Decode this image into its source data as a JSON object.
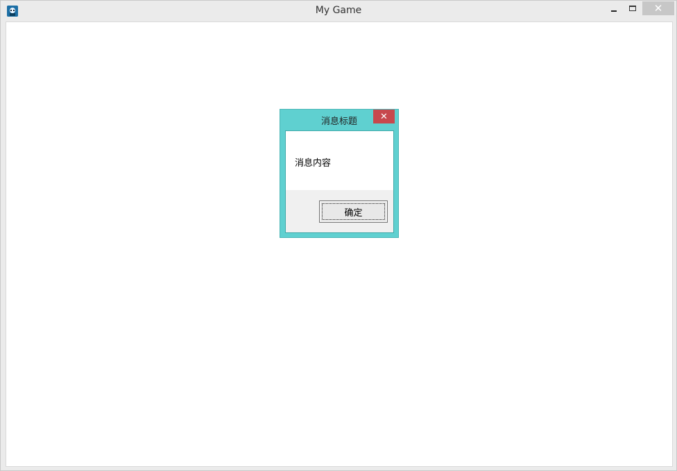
{
  "window": {
    "title": "My Game",
    "app_icon": "game-app-icon",
    "controls": {
      "minimize": "minimize-icon",
      "maximize": "maximize-icon",
      "close": "✕"
    }
  },
  "dialog": {
    "title": "消息标题",
    "close_label": "✕",
    "message": "消息内容",
    "ok_label": "确定",
    "accent_color": "#5fd0d0",
    "close_color": "#c7484d"
  }
}
